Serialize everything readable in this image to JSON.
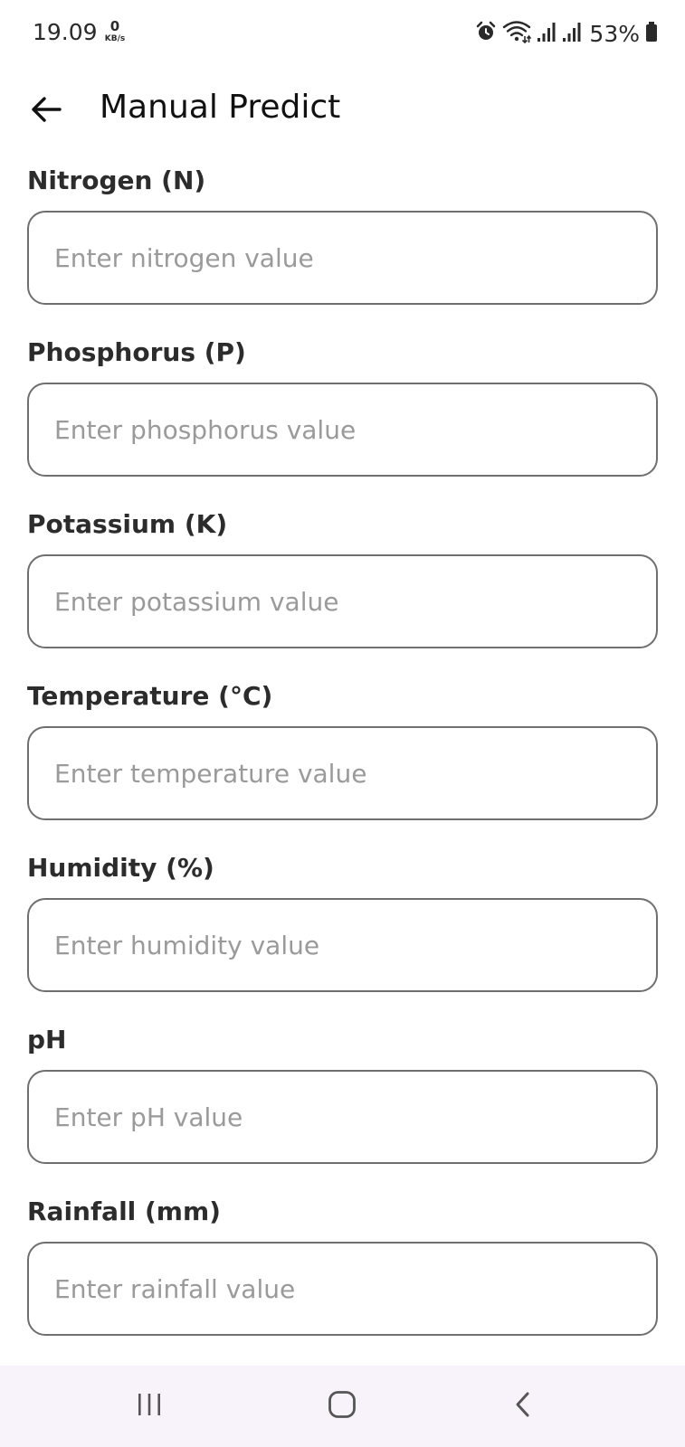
{
  "status_bar": {
    "time": "19.09",
    "net_speed_value": "0",
    "net_speed_unit": "KB/s",
    "battery_percent": "53%",
    "icons": [
      "alarm-icon",
      "wifi-icon",
      "signal-icon",
      "signal-icon",
      "battery-icon"
    ]
  },
  "app_bar": {
    "title": "Manual Predict",
    "back_icon": "arrow-left-icon"
  },
  "form": {
    "fields": [
      {
        "label": "Nitrogen (N)",
        "placeholder": "Enter nitrogen value",
        "value": ""
      },
      {
        "label": "Phosphorus (P)",
        "placeholder": "Enter phosphorus value",
        "value": ""
      },
      {
        "label": "Potassium (K)",
        "placeholder": "Enter potassium value",
        "value": ""
      },
      {
        "label": "Temperature (°C)",
        "placeholder": "Enter temperature value",
        "value": ""
      },
      {
        "label": "Humidity (%)",
        "placeholder": "Enter humidity value",
        "value": ""
      },
      {
        "label": "pH",
        "placeholder": "Enter pH value",
        "value": ""
      },
      {
        "label": "Rainfall (mm)",
        "placeholder": "Enter rainfall value",
        "value": ""
      }
    ]
  },
  "nav_bar": {
    "buttons": [
      "recent-apps-icon",
      "home-icon",
      "back-icon"
    ]
  },
  "colors": {
    "background": "#ffffff",
    "input_border": "#6f6f6f",
    "placeholder": "#9a9a9a",
    "nav_background": "#f8f3fa"
  }
}
